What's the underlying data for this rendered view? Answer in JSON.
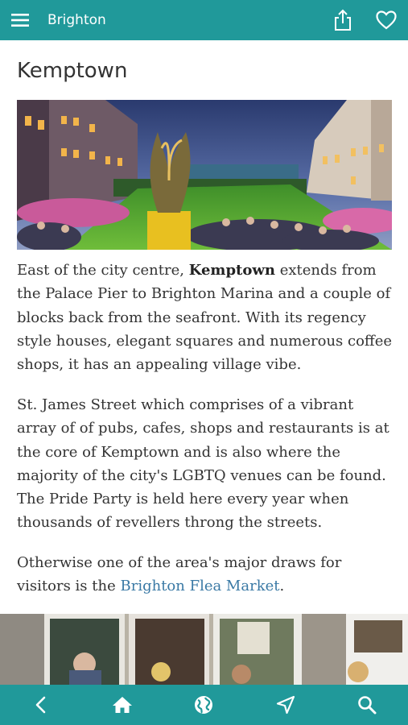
{
  "header": {
    "title": "Brighton",
    "icons": [
      "hamburger-menu-icon",
      "share-icon",
      "heart-icon"
    ]
  },
  "page": {
    "title": "Kemptown",
    "paragraph1": {
      "before": "East of the city centre, ",
      "bold": "Kemptown",
      "after": " extends from the Palace Pier to Brighton Marina and a couple of blocks back from the seafront. With its regency style houses, elegant squares and numerous coffee shops, it has an appealing village vibe."
    },
    "paragraph2": "St. James Street which comprises of a vibrant array of of pubs, cafes, shops and restaurants is at the core of Kemptown and is also where the majority of the city's LGBTQ venues can be found. The Pride Party is held here every year when thousands of revellers throng the streets.",
    "paragraph3": {
      "before": "Otherwise one of the area's major draws for visitors is the ",
      "link": "Brighton Flea Market",
      "after": "."
    }
  },
  "bottom_nav": [
    "back-icon",
    "home-icon",
    "globe-icon",
    "navigation-arrow-icon",
    "search-icon"
  ],
  "colors": {
    "bar": "#20999a",
    "link": "#3a79a5",
    "text": "#333333"
  }
}
